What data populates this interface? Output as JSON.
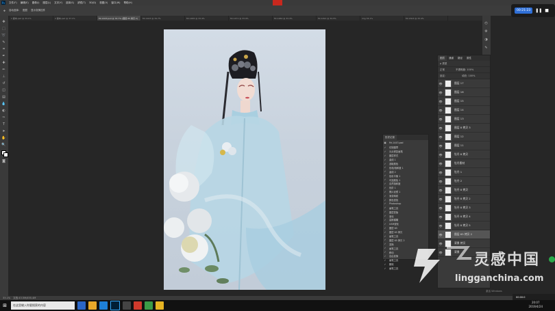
{
  "menu": [
    "文件(F)",
    "编辑(E)",
    "图像(I)",
    "图层(L)",
    "文字(Y)",
    "选择(S)",
    "滤镜(T)",
    "3D(D)",
    "视图(V)",
    "窗口(W)",
    "帮助(H)"
  ],
  "recorder": {
    "time": "00:21:23"
  },
  "options_bar": [
    "自动选择:",
    "图层",
    "显示变换控件"
  ],
  "tabs": [
    {
      "label": "1 副本.psd @ 33.1%",
      "active": false
    },
    {
      "label": "2 副本.psd @ 37.1%",
      "active": false
    },
    {
      "label": "Mr-1443.psd @ 33.7% (图层 65 拷贝 2)",
      "active": true
    },
    {
      "label": "Mr-1443 @ 34.7%",
      "active": false
    },
    {
      "label": "Mr-1465 @ 33.4%",
      "active": false
    },
    {
      "label": "Mr-1471 @ 33.9%",
      "active": false
    },
    {
      "label": "Mr-1482 @ 33.3%",
      "active": false
    },
    {
      "label": "Mr-1491 @ 34.5%",
      "active": false
    },
    {
      "label": "img 33.1%",
      "active": false
    },
    {
      "label": "Mr-1503 @ 33.4%",
      "active": false
    }
  ],
  "status": {
    "zoom": "33.1%",
    "info": "文档:43.5M/455.4M"
  },
  "layers_panel": {
    "tabs": [
      "图层",
      "通道",
      "路径",
      "属性"
    ],
    "filter_label": "ρ 类型",
    "blend_mode": "正常",
    "opacity_label": "不透明度: 100%",
    "fill_label": "填充: 100%",
    "lock_label": "锁定:",
    "layers": [
      {
        "name": "图层 17",
        "selected": false
      },
      {
        "name": "图层 16",
        "selected": false
      },
      {
        "name": "图层 15",
        "selected": false
      },
      {
        "name": "图层 14",
        "selected": false
      },
      {
        "name": "图层 13",
        "selected": false
      },
      {
        "name": "图层 8 拷贝 3",
        "selected": false
      },
      {
        "name": "图层 12",
        "selected": false
      },
      {
        "name": "图层 11",
        "selected": false
      },
      {
        "name": "牡丹 8 拷贝",
        "selected": false
      },
      {
        "name": "牡丹素材",
        "selected": false
      },
      {
        "name": "牡丹 1",
        "selected": false
      },
      {
        "name": "牡丹 2",
        "selected": false
      },
      {
        "name": "牡丹 8 拷贝",
        "selected": false
      },
      {
        "name": "牡丹 8 拷贝 2",
        "selected": false
      },
      {
        "name": "牡丹 8 拷贝 3",
        "selected": false
      },
      {
        "name": "牡丹 8 拷贝 4",
        "selected": false
      },
      {
        "name": "牡丹 8 拷贝 5",
        "selected": false
      },
      {
        "name": "图层 65 拷贝 2",
        "selected": true
      },
      {
        "name": "背景 拷贝",
        "selected": false
      },
      {
        "name": "背景",
        "selected": false
      }
    ]
  },
  "history_panel": {
    "title": "历史记录",
    "snapshot": "Mr-1443.psd",
    "items": [
      "仿制图章",
      "污点修复画笔",
      "图层样式",
      "曲线 1",
      "选取颜色",
      "色相/饱和度 1",
      "曲线 2",
      "色彩平衡 1",
      "可选颜色 1",
      "自然饱和度",
      "色阶 1",
      "照片滤镜 1",
      "渐变映射",
      "颜色查找",
      "Photoshop",
      "画笔工具",
      "图层蒙版",
      "液化",
      "高斯模糊",
      "USM锐化",
      "图层 65",
      "图层 65 拷贝",
      "画笔工具",
      "图层 65 拷贝 2",
      "变换",
      "画笔工具",
      "移动",
      "自由变换",
      "画笔工具",
      "删除",
      "画笔工具"
    ]
  },
  "watermark": {
    "cn": "灵感中国",
    "url": "lingganchina.com"
  },
  "taskbar": {
    "search": "在这里输入你要搜索的内容",
    "time": "20:07",
    "date": "2019/4/24"
  },
  "windows_notice": "激活 Windows",
  "bottom_recorder": "00:00:0"
}
